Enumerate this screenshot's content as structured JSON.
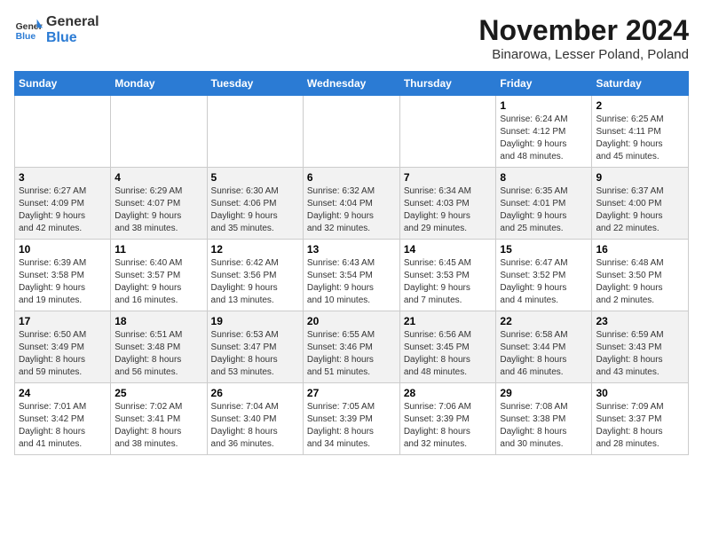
{
  "logo": {
    "line1": "General",
    "line2": "Blue"
  },
  "title": "November 2024",
  "location": "Binarowa, Lesser Poland, Poland",
  "weekdays": [
    "Sunday",
    "Monday",
    "Tuesday",
    "Wednesday",
    "Thursday",
    "Friday",
    "Saturday"
  ],
  "weeks": [
    [
      {
        "day": "",
        "info": ""
      },
      {
        "day": "",
        "info": ""
      },
      {
        "day": "",
        "info": ""
      },
      {
        "day": "",
        "info": ""
      },
      {
        "day": "",
        "info": ""
      },
      {
        "day": "1",
        "info": "Sunrise: 6:24 AM\nSunset: 4:12 PM\nDaylight: 9 hours\nand 48 minutes."
      },
      {
        "day": "2",
        "info": "Sunrise: 6:25 AM\nSunset: 4:11 PM\nDaylight: 9 hours\nand 45 minutes."
      }
    ],
    [
      {
        "day": "3",
        "info": "Sunrise: 6:27 AM\nSunset: 4:09 PM\nDaylight: 9 hours\nand 42 minutes."
      },
      {
        "day": "4",
        "info": "Sunrise: 6:29 AM\nSunset: 4:07 PM\nDaylight: 9 hours\nand 38 minutes."
      },
      {
        "day": "5",
        "info": "Sunrise: 6:30 AM\nSunset: 4:06 PM\nDaylight: 9 hours\nand 35 minutes."
      },
      {
        "day": "6",
        "info": "Sunrise: 6:32 AM\nSunset: 4:04 PM\nDaylight: 9 hours\nand 32 minutes."
      },
      {
        "day": "7",
        "info": "Sunrise: 6:34 AM\nSunset: 4:03 PM\nDaylight: 9 hours\nand 29 minutes."
      },
      {
        "day": "8",
        "info": "Sunrise: 6:35 AM\nSunset: 4:01 PM\nDaylight: 9 hours\nand 25 minutes."
      },
      {
        "day": "9",
        "info": "Sunrise: 6:37 AM\nSunset: 4:00 PM\nDaylight: 9 hours\nand 22 minutes."
      }
    ],
    [
      {
        "day": "10",
        "info": "Sunrise: 6:39 AM\nSunset: 3:58 PM\nDaylight: 9 hours\nand 19 minutes."
      },
      {
        "day": "11",
        "info": "Sunrise: 6:40 AM\nSunset: 3:57 PM\nDaylight: 9 hours\nand 16 minutes."
      },
      {
        "day": "12",
        "info": "Sunrise: 6:42 AM\nSunset: 3:56 PM\nDaylight: 9 hours\nand 13 minutes."
      },
      {
        "day": "13",
        "info": "Sunrise: 6:43 AM\nSunset: 3:54 PM\nDaylight: 9 hours\nand 10 minutes."
      },
      {
        "day": "14",
        "info": "Sunrise: 6:45 AM\nSunset: 3:53 PM\nDaylight: 9 hours\nand 7 minutes."
      },
      {
        "day": "15",
        "info": "Sunrise: 6:47 AM\nSunset: 3:52 PM\nDaylight: 9 hours\nand 4 minutes."
      },
      {
        "day": "16",
        "info": "Sunrise: 6:48 AM\nSunset: 3:50 PM\nDaylight: 9 hours\nand 2 minutes."
      }
    ],
    [
      {
        "day": "17",
        "info": "Sunrise: 6:50 AM\nSunset: 3:49 PM\nDaylight: 8 hours\nand 59 minutes."
      },
      {
        "day": "18",
        "info": "Sunrise: 6:51 AM\nSunset: 3:48 PM\nDaylight: 8 hours\nand 56 minutes."
      },
      {
        "day": "19",
        "info": "Sunrise: 6:53 AM\nSunset: 3:47 PM\nDaylight: 8 hours\nand 53 minutes."
      },
      {
        "day": "20",
        "info": "Sunrise: 6:55 AM\nSunset: 3:46 PM\nDaylight: 8 hours\nand 51 minutes."
      },
      {
        "day": "21",
        "info": "Sunrise: 6:56 AM\nSunset: 3:45 PM\nDaylight: 8 hours\nand 48 minutes."
      },
      {
        "day": "22",
        "info": "Sunrise: 6:58 AM\nSunset: 3:44 PM\nDaylight: 8 hours\nand 46 minutes."
      },
      {
        "day": "23",
        "info": "Sunrise: 6:59 AM\nSunset: 3:43 PM\nDaylight: 8 hours\nand 43 minutes."
      }
    ],
    [
      {
        "day": "24",
        "info": "Sunrise: 7:01 AM\nSunset: 3:42 PM\nDaylight: 8 hours\nand 41 minutes."
      },
      {
        "day": "25",
        "info": "Sunrise: 7:02 AM\nSunset: 3:41 PM\nDaylight: 8 hours\nand 38 minutes."
      },
      {
        "day": "26",
        "info": "Sunrise: 7:04 AM\nSunset: 3:40 PM\nDaylight: 8 hours\nand 36 minutes."
      },
      {
        "day": "27",
        "info": "Sunrise: 7:05 AM\nSunset: 3:39 PM\nDaylight: 8 hours\nand 34 minutes."
      },
      {
        "day": "28",
        "info": "Sunrise: 7:06 AM\nSunset: 3:39 PM\nDaylight: 8 hours\nand 32 minutes."
      },
      {
        "day": "29",
        "info": "Sunrise: 7:08 AM\nSunset: 3:38 PM\nDaylight: 8 hours\nand 30 minutes."
      },
      {
        "day": "30",
        "info": "Sunrise: 7:09 AM\nSunset: 3:37 PM\nDaylight: 8 hours\nand 28 minutes."
      }
    ]
  ]
}
